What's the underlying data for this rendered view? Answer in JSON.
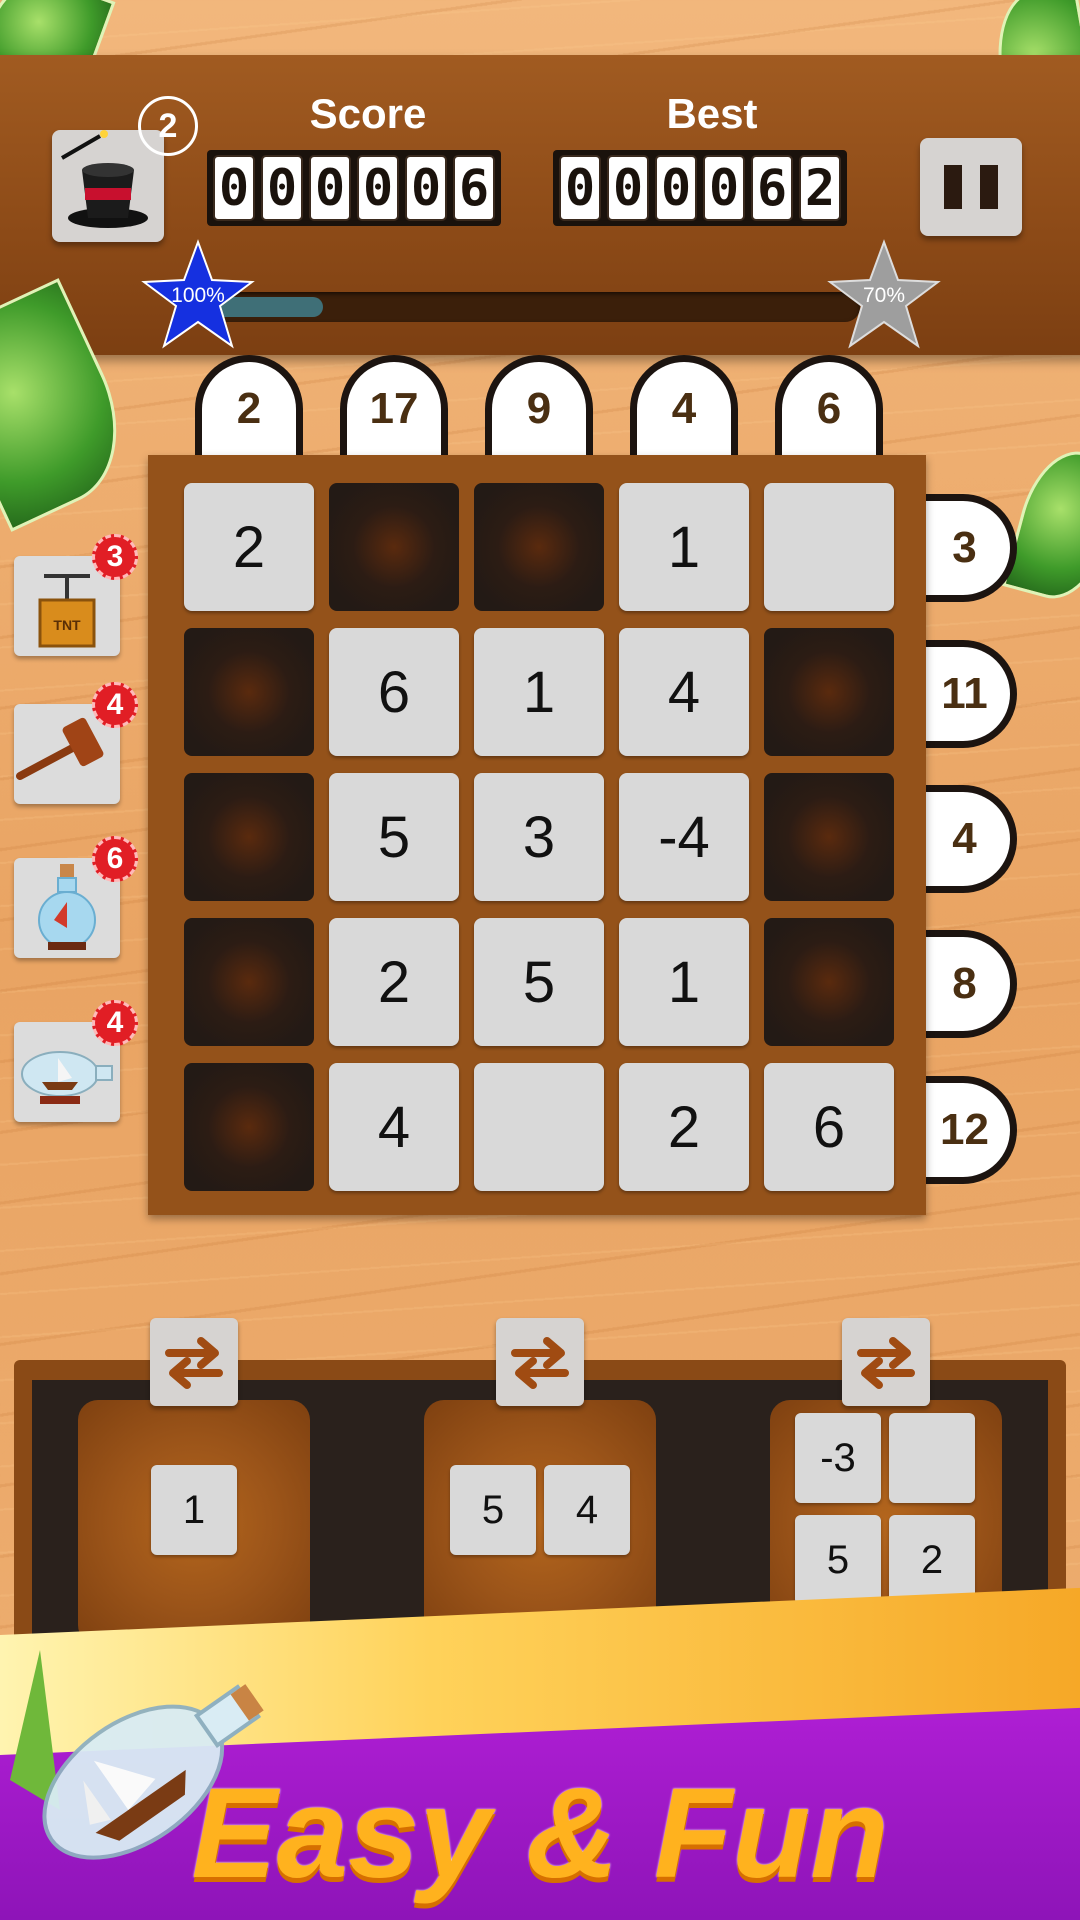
{
  "header": {
    "score_label": "Score",
    "best_label": "Best",
    "score_digits": [
      "0",
      "0",
      "0",
      "0",
      "0",
      "6"
    ],
    "best_digits": [
      "0",
      "0",
      "0",
      "0",
      "6",
      "2"
    ],
    "hint_count": "2",
    "hint_icon": "magic-hat-icon",
    "pause_icon": "pause-icon"
  },
  "progress": {
    "fill_fraction": 0.17,
    "left_star_label": "100%",
    "right_star_label": "70%",
    "left_star_color": "#1530e0",
    "right_star_color": "#9e9e9e"
  },
  "board": {
    "column_clues": [
      "2",
      "17",
      "9",
      "4",
      "6"
    ],
    "row_clues": [
      "3",
      "11",
      "4",
      "8",
      "12"
    ],
    "cells": [
      [
        {
          "type": "filled",
          "value": "2"
        },
        {
          "type": "empty",
          "value": ""
        },
        {
          "type": "empty",
          "value": ""
        },
        {
          "type": "filled",
          "value": "1"
        },
        {
          "type": "filled",
          "value": ""
        }
      ],
      [
        {
          "type": "empty",
          "value": ""
        },
        {
          "type": "filled",
          "value": "6"
        },
        {
          "type": "filled",
          "value": "1"
        },
        {
          "type": "filled",
          "value": "4"
        },
        {
          "type": "empty",
          "value": ""
        }
      ],
      [
        {
          "type": "empty",
          "value": ""
        },
        {
          "type": "filled",
          "value": "5"
        },
        {
          "type": "filled",
          "value": "3"
        },
        {
          "type": "filled",
          "value": "-4"
        },
        {
          "type": "empty",
          "value": ""
        }
      ],
      [
        {
          "type": "empty",
          "value": ""
        },
        {
          "type": "filled",
          "value": "2"
        },
        {
          "type": "filled",
          "value": "5"
        },
        {
          "type": "filled",
          "value": "1"
        },
        {
          "type": "empty",
          "value": ""
        }
      ],
      [
        {
          "type": "empty",
          "value": ""
        },
        {
          "type": "filled",
          "value": "4"
        },
        {
          "type": "filled",
          "value": ""
        },
        {
          "type": "filled",
          "value": "2"
        },
        {
          "type": "filled",
          "value": "6"
        }
      ]
    ]
  },
  "powerups": [
    {
      "name": "tnt",
      "icon": "tnt-crate-icon",
      "label": "TNT",
      "count": "3"
    },
    {
      "name": "hammer",
      "icon": "gavel-icon",
      "count": "4"
    },
    {
      "name": "potion",
      "icon": "bottle-potion-icon",
      "count": "6"
    },
    {
      "name": "ship-bottle",
      "icon": "ship-in-bottle-icon",
      "count": "4"
    }
  ],
  "pieces": {
    "swap_icon": "swap-arrows-icon",
    "slot1": [
      "1"
    ],
    "slot2": [
      "5",
      "4"
    ],
    "slot3": [
      "-3",
      "",
      "5",
      "2"
    ]
  },
  "banner": {
    "text": "Easy & Fun",
    "colors": {
      "purple": "#a319c9",
      "gold": "#ffb21e"
    }
  }
}
